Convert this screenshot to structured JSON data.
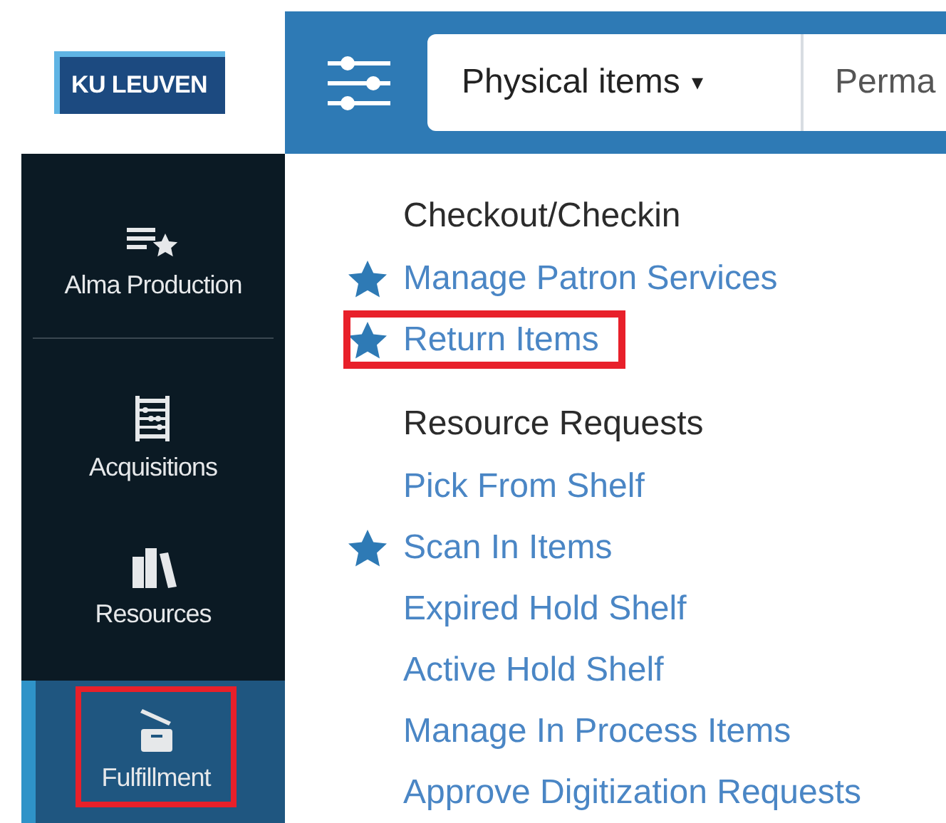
{
  "logo": {
    "text": "KU LEUVEN"
  },
  "topbar": {
    "scope_dropdown": {
      "label": "Physical items",
      "caret": "▾"
    },
    "search_field": {
      "value": "Perma"
    }
  },
  "sidebar": {
    "items": [
      {
        "label": "Alma Production",
        "selected": false,
        "highlighted": false
      },
      {
        "label": "Acquisitions",
        "selected": false,
        "highlighted": false
      },
      {
        "label": "Resources",
        "selected": false,
        "highlighted": false
      },
      {
        "label": "Fulfillment",
        "selected": true,
        "highlighted": true
      }
    ]
  },
  "menu": {
    "sections": [
      {
        "heading": "Checkout/Checkin",
        "items": [
          {
            "label": "Manage Patron Services",
            "starred": true,
            "highlighted": false
          },
          {
            "label": "Return Items",
            "starred": true,
            "highlighted": true
          }
        ]
      },
      {
        "heading": "Resource Requests",
        "items": [
          {
            "label": "Pick From Shelf",
            "starred": false,
            "highlighted": false
          },
          {
            "label": "Scan In Items",
            "starred": true,
            "highlighted": false
          },
          {
            "label": "Expired Hold Shelf",
            "starred": false,
            "highlighted": false
          },
          {
            "label": "Active Hold Shelf",
            "starred": false,
            "highlighted": false
          },
          {
            "label": "Manage In Process Items",
            "starred": false,
            "highlighted": false
          },
          {
            "label": "Approve Digitization Requests",
            "starred": false,
            "highlighted": false
          }
        ]
      }
    ]
  }
}
